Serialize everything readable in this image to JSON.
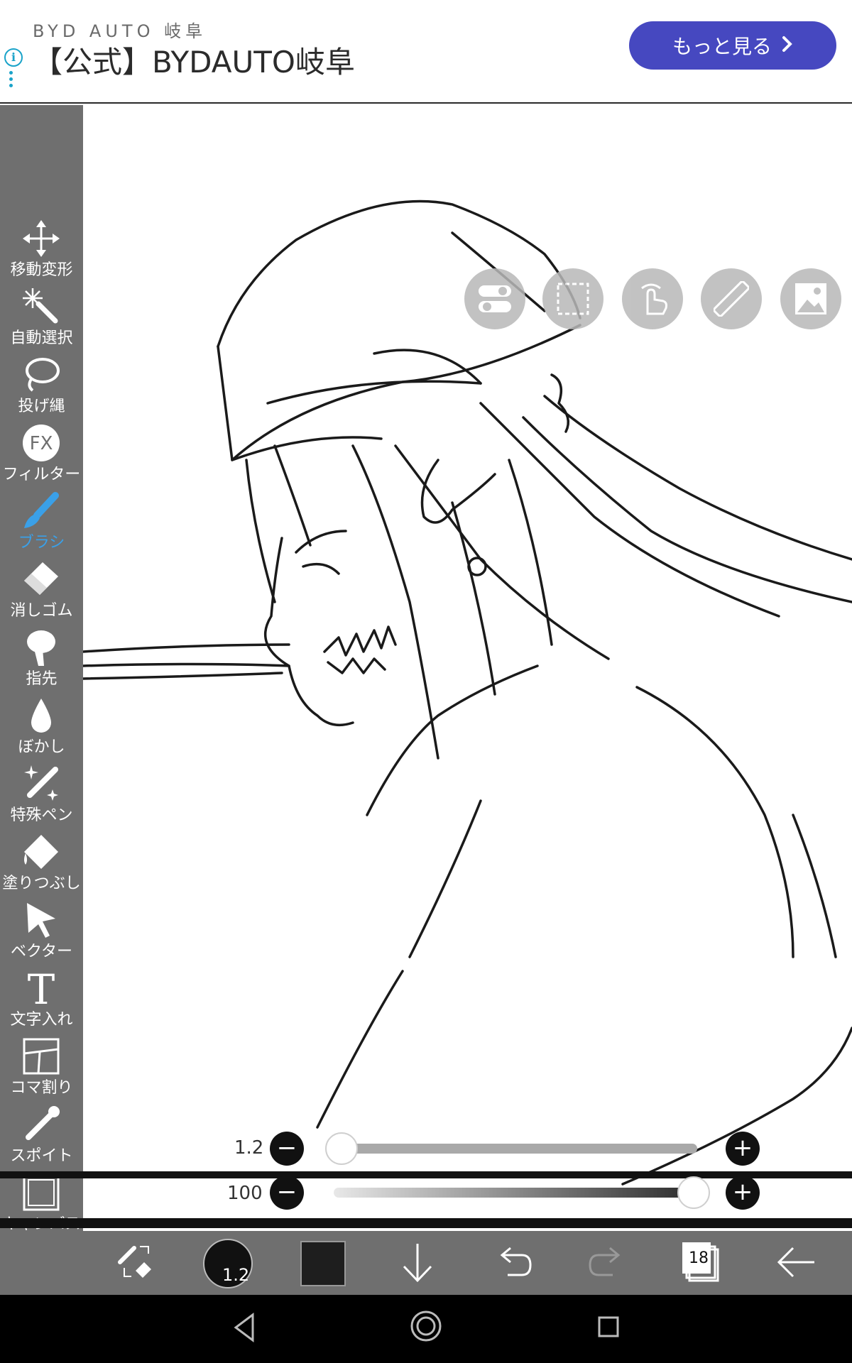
{
  "ad": {
    "subtitle": "BYD AUTO 岐阜",
    "title": "【公式】BYDAUTO岐阜",
    "button_label": "もっと見る",
    "info_icon": "info-icon",
    "accent": "#4648c0"
  },
  "toolbar": {
    "items": [
      {
        "label": "移動変形",
        "icon": "move-transform-icon"
      },
      {
        "label": "自動選択",
        "icon": "magic-wand-icon"
      },
      {
        "label": "投げ縄",
        "icon": "lasso-icon"
      },
      {
        "label": "フィルター",
        "icon": "fx-filter-icon"
      },
      {
        "label": "ブラシ",
        "icon": "brush-icon",
        "active": true
      },
      {
        "label": "消しゴム",
        "icon": "eraser-icon"
      },
      {
        "label": "指先",
        "icon": "finger-smudge-icon"
      },
      {
        "label": "ぼかし",
        "icon": "blur-drop-icon"
      },
      {
        "label": "特殊ペン",
        "icon": "special-pen-icon"
      },
      {
        "label": "塗りつぶし",
        "icon": "fill-bucket-icon"
      },
      {
        "label": "ベクター",
        "icon": "vector-cursor-icon"
      },
      {
        "label": "文字入れ",
        "icon": "text-icon"
      },
      {
        "label": "コマ割り",
        "icon": "frame-divide-icon"
      },
      {
        "label": "スポイト",
        "icon": "eyedropper-icon"
      },
      {
        "label": "キャンバス",
        "icon": "canvas-icon"
      }
    ],
    "active_color": "#3aa0e8"
  },
  "floating": [
    "toggle-icon",
    "selection-icon",
    "touch-icon",
    "ruler-icon",
    "image-icon"
  ],
  "brush_size": {
    "value": "1.2",
    "minus": "−",
    "plus": "+",
    "fraction": 0.0
  },
  "opacity": {
    "value": "100",
    "minus": "−",
    "plus": "+",
    "fraction": 1.0
  },
  "bottom": {
    "brush_size_label": "1.2",
    "layer_count": "18",
    "color": "#1e1e1e"
  }
}
